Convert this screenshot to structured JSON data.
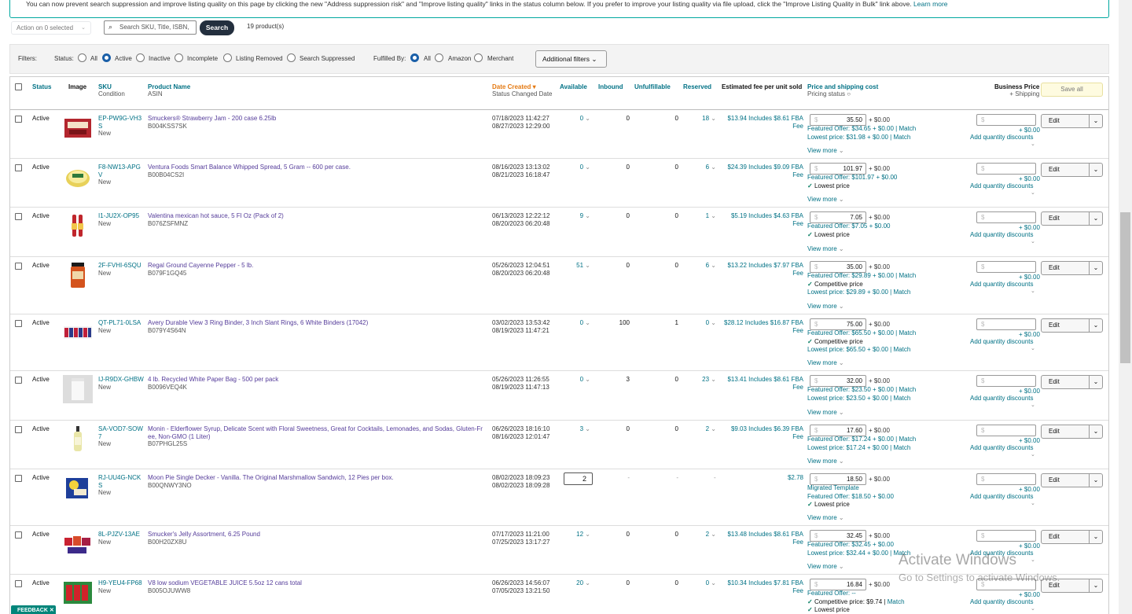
{
  "banner": {
    "text": "You can now prevent search suppression and improve listing quality on this page by clicking the new \"Address suppression risk\" and \"Improve listing quality\" links in the status column below. If you prefer to improve your listing quality via file upload, click the \"Improve Listing Quality in Bulk\" link above.",
    "link": "Learn more"
  },
  "toolbar": {
    "action_label": "Action on 0 selected",
    "search_placeholder": "Search SKU, Title, ISBN,",
    "search_button": "Search",
    "count": "19 product(s)"
  },
  "filters": {
    "label": "Filters:",
    "status_label": "Status:",
    "status_options": [
      "All",
      "Active",
      "Inactive",
      "Incomplete",
      "Listing Removed",
      "Search Suppressed"
    ],
    "status_selected": "Active",
    "fulfilled_label": "Fulfilled By:",
    "fulfilled_options": [
      "All",
      "Amazon",
      "Merchant"
    ],
    "fulfilled_selected": "All",
    "additional": "Additional filters"
  },
  "columns": {
    "status": "Status",
    "image": "Image",
    "sku": "SKU",
    "condition": "Condition",
    "product_name": "Product Name",
    "asin": "ASIN",
    "date_created": "Date Created",
    "status_changed": "Status Changed Date",
    "available": "Available",
    "inbound": "Inbound",
    "unfulfillable": "Unfulfillable",
    "reserved": "Reserved",
    "fee": "Estimated fee per unit sold",
    "price": "Price and shipping cost",
    "pricing_status": "Pricing status",
    "business_price": "Business Price",
    "plus_shipping": "+ Shipping",
    "save_all": "Save all"
  },
  "common": {
    "view_more": "View more",
    "add_qty": "Add quantity discounts",
    "edit": "Edit",
    "ship": "+ $0.00",
    "dollar": "$"
  },
  "rows": [
    {
      "status": "Active",
      "sku": "EP-PW9G-VH3S",
      "condition": "New",
      "name": "Smuckers® Strawberry Jam - 200 case 6.25lb",
      "asin": "B004KSS7SK",
      "created": "07/18/2023 11:42:27",
      "changed": "08/27/2023 12:29:00",
      "available": "0",
      "inbound": "0",
      "unfulfillable": "0",
      "reserved": "18",
      "fee": "$13.94 Includes $8.61 FBA",
      "fee2": "Fee",
      "price": "35.50",
      "ship": "+ $0.00",
      "l1": "Featured Offer: $34.65 + $0.00 | ",
      "l1b": "Match",
      "l2": "Lowest price: $31.98 + $0.00 | ",
      "l2b": "Match"
    },
    {
      "status": "Active",
      "sku": "F8-NW13-APGV",
      "condition": "New",
      "name": "Ventura Foods Smart Balance Whipped Spread, 5 Gram -- 600 per case.",
      "asin": "B00B04CS2I",
      "created": "08/16/2023 13:13:02",
      "changed": "08/21/2023 16:18:47",
      "available": "0",
      "inbound": "0",
      "unfulfillable": "0",
      "reserved": "6",
      "fee": "$24.39 Includes $9.09 FBA",
      "fee2": "Fee",
      "price": "101.97",
      "ship": "+ $0.00",
      "l1": "Featured Offer: $101.97 + $0.00",
      "l2": "Lowest price"
    },
    {
      "status": "Active",
      "sku": "I1-JU2X-OP95",
      "condition": "New",
      "name": "Valentina mexican hot sauce, 5 Fl Oz (Pack of 2)",
      "asin": "B076ZSFMNZ",
      "created": "06/13/2023 12:22:12",
      "changed": "08/20/2023 06:20:48",
      "available": "9",
      "inbound": "0",
      "unfulfillable": "0",
      "reserved": "1",
      "fee": "$5.19 Includes $4.63 FBA",
      "fee2": "Fee",
      "price": "7.05",
      "ship": "+ $0.00",
      "l1": "Featured Offer: $7.05 + $0.00",
      "l2": "Lowest price"
    },
    {
      "status": "Active",
      "sku": "2F-FVHI-6SQU",
      "condition": "New",
      "name": "Regal Ground Cayenne Pepper - 5 lb.",
      "asin": "B079F1GQ45",
      "created": "05/26/2023 12:04:51",
      "changed": "08/20/2023 06:20:48",
      "available": "51",
      "inbound": "0",
      "unfulfillable": "0",
      "reserved": "6",
      "fee": "$13.22 Includes $7.97 FBA",
      "fee2": "Fee",
      "price": "35.00",
      "ship": "+ $0.00",
      "l1": "Featured Offer: $29.89 + $0.00 | ",
      "l1b": "Match",
      "l2": "Competitive price",
      "l3": "Lowest price: $29.89 + $0.00 | ",
      "l3b": "Match"
    },
    {
      "status": "Active",
      "sku": "QT-PL71-0LSA",
      "condition": "New",
      "name": "Avery Durable View 3 Ring Binder, 3 Inch Slant Rings, 6 White Binders (17042)",
      "asin": "B079Y4S64N",
      "created": "03/02/2023 13:53:42",
      "changed": "08/19/2023 11:47:21",
      "available": "0",
      "inbound": "100",
      "unfulfillable": "1",
      "reserved": "0",
      "fee": "$28.12 Includes $16.87 FBA",
      "fee2": "Fee",
      "price": "75.00",
      "ship": "+ $0.00",
      "l1": "Featured Offer: $65.50 + $0.00 | ",
      "l1b": "Match",
      "l2": "Competitive price",
      "l3": "Lowest price: $65.50 + $0.00 | ",
      "l3b": "Match"
    },
    {
      "status": "Active",
      "sku": "IJ-R9DX-GHBW",
      "condition": "New",
      "name": "4 lb. Recycled White Paper Bag - 500 per pack",
      "asin": "B0096VEQ4K",
      "created": "05/26/2023 11:26:55",
      "changed": "08/19/2023 11:47:13",
      "available": "0",
      "inbound": "3",
      "unfulfillable": "0",
      "reserved": "23",
      "fee": "$13.41 Includes $8.61 FBA",
      "fee2": "Fee",
      "price": "32.00",
      "ship": "+ $0.00",
      "l1": "Featured Offer: $23.50 + $0.00 | ",
      "l1b": "Match",
      "l2": "Lowest price: $23.50 + $0.00 | ",
      "l2b": "Match"
    },
    {
      "status": "Active",
      "sku": "SA-VOD7-SOW7",
      "condition": "New",
      "name": "Monin - Elderflower Syrup, Delicate Scent with Floral Sweetness, Great for Cocktails, Lemonades, and Sodas, Gluten-Fr ee, Non-GMO (1 Liter)",
      "asin": "B07PHGL25S",
      "created": "06/26/2023 18:16:10",
      "changed": "08/16/2023 12:01:47",
      "available": "3",
      "inbound": "0",
      "unfulfillable": "0",
      "reserved": "2",
      "fee": "$9.03 Includes $6.39 FBA",
      "fee2": "Fee",
      "price": "17.60",
      "ship": "+ $0.00",
      "l1": "Featured Offer: $17.24 + $0.00 | ",
      "l1b": "Match",
      "l2": "Lowest price: $17.24 + $0.00 | ",
      "l2b": "Match"
    },
    {
      "status": "Active",
      "sku": "RJ-UU4G-NCKS",
      "condition": "New",
      "name": "Moon Pie Single Decker - Vanilla. The Original Marshmallow Sandwich, 12 Pies per box.",
      "asin": "B00QNWY3NO",
      "created": "08/02/2023 18:09:23",
      "changed": "08/02/2023 18:09:28",
      "available": "2",
      "inbound": "-",
      "unfulfillable": "-",
      "reserved": "",
      "fee": "$2.78",
      "fee2": "",
      "price": "18.50",
      "ship": "+ $0.00",
      "l0": "Migrated Template",
      "l1": "Featured Offer: $18.50 + $0.00",
      "l2": "Lowest price"
    },
    {
      "status": "Active",
      "sku": "8L-PJZV-13AE",
      "condition": "New",
      "name": "Smucker's Jelly Assortment, 6.25 Pound",
      "asin": "B00H20ZX8U",
      "created": "07/17/2023 11:21:00",
      "changed": "07/25/2023 13:17:27",
      "available": "12",
      "inbound": "0",
      "unfulfillable": "0",
      "reserved": "2",
      "fee": "$13.48 Includes $8.61 FBA",
      "fee2": "Fee",
      "price": "32.45",
      "ship": "+ $0.00",
      "l1": "Featured Offer: $32.45 + $0.00",
      "l2": "Lowest price: $32.44 + $0.00 | ",
      "l2b": "Match"
    },
    {
      "status": "Active",
      "sku": "H9-YEU4-FP68",
      "condition": "New",
      "name": "V8 low sodium VEGETABLE JUICE 5.5oz 12 cans total",
      "asin": "B005OJUWW8",
      "created": "06/26/2023 14:56:07",
      "changed": "07/05/2023 13:21:50",
      "available": "20",
      "inbound": "0",
      "unfulfillable": "0",
      "reserved": "0",
      "fee": "$10.34 Includes $7.81 FBA",
      "fee2": "Fee",
      "price": "16.84",
      "ship": "+ $0.00",
      "l1": "Featured Offer: --",
      "l2": "Competitive price: $9.74   | ",
      "l2b": "Match",
      "l3": "Lowest price"
    }
  ],
  "watermark": {
    "title": "Activate Windows",
    "sub": "Go to Settings to activate Windows."
  },
  "feedback": "FEEDBACK ✕"
}
